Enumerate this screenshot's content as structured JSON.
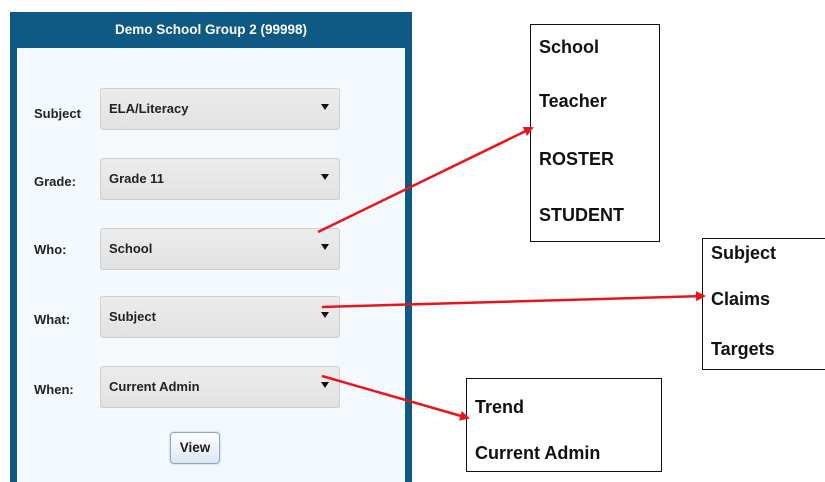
{
  "panel": {
    "title": "Demo School Group 2 (99998)",
    "fields": {
      "subject": {
        "label": "Subject",
        "value": "ELA/Literacy"
      },
      "grade": {
        "label": "Grade:",
        "value": "Grade 11"
      },
      "who": {
        "label": "Who:",
        "value": "School"
      },
      "what": {
        "label": "What:",
        "value": "Subject"
      },
      "when": {
        "label": "When:",
        "value": "Current Admin"
      }
    },
    "view_label": "View"
  },
  "callouts": {
    "who_options": [
      "School",
      "Teacher",
      "ROSTER",
      "STUDENT"
    ],
    "what_options": [
      "Subject",
      "Claims",
      "Targets"
    ],
    "when_options": [
      "Trend",
      "Current Admin"
    ]
  },
  "colors": {
    "panel": "#0e5a84",
    "panel_body": "#f4f9fd",
    "arrow": "#e8161b"
  },
  "icons": {
    "dropdown": "caret-down-icon"
  }
}
